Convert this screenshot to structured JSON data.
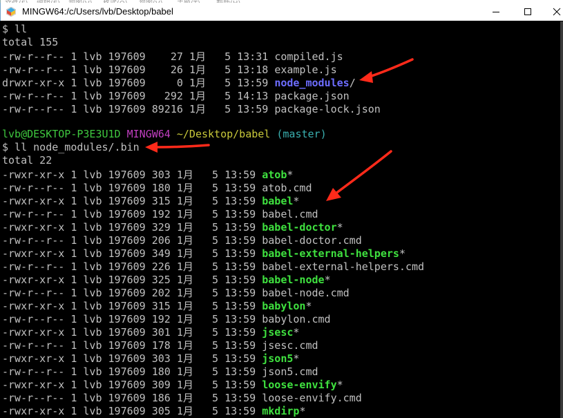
{
  "menu": [
    "文件(F)",
    "编辑(E)",
    "视图(V)",
    "格式(O)",
    "视图(V)",
    "主题(T)",
    "帮助(H)"
  ],
  "window": {
    "title": "MINGW64:/c/Users/lvb/Desktop/babel",
    "minimize_glyph": "—",
    "maximize_glyph": "☐",
    "close_glyph": "✕",
    "icon": "mingw-app-icon"
  },
  "terminal": {
    "command1": "$ ll",
    "total1": "total 155",
    "files1": [
      {
        "perms": "-rw-r--r--",
        "links": "1",
        "owner": "lvb",
        "group": "197609",
        "size": "   27",
        "month": "1月",
        "day": "5",
        "time": "13:31",
        "name": "compiled.js",
        "type": "file"
      },
      {
        "perms": "-rw-r--r--",
        "links": "1",
        "owner": "lvb",
        "group": "197609",
        "size": "   26",
        "month": "1月",
        "day": "5",
        "time": "13:18",
        "name": "example.js",
        "type": "file"
      },
      {
        "perms": "drwxr-xr-x",
        "links": "1",
        "owner": "lvb",
        "group": "197609",
        "size": "    0",
        "month": "1月",
        "day": "5",
        "time": "13:59",
        "name": "node_modules",
        "suffix": "/",
        "type": "dir"
      },
      {
        "perms": "-rw-r--r--",
        "links": "1",
        "owner": "lvb",
        "group": "197609",
        "size": "  292",
        "month": "1月",
        "day": "5",
        "time": "14:13",
        "name": "package.json",
        "type": "file"
      },
      {
        "perms": "-rw-r--r--",
        "links": "1",
        "owner": "lvb",
        "group": "197609",
        "size": "89216",
        "month": "1月",
        "day": "5",
        "time": "13:59",
        "name": "package-lock.json",
        "type": "file"
      }
    ],
    "prompt": {
      "user_host": "lvb@DESKTOP-P3E3U1D",
      "shell": "MINGW64",
      "path": "~/Desktop/babel",
      "branch": "(master)"
    },
    "command2": "$ ll node_modules/.bin",
    "total2": "total 22",
    "files2": [
      {
        "perms": "-rwxr-xr-x",
        "size": "303",
        "time": "13:59",
        "name": "atob",
        "suffix": "*",
        "type": "exe"
      },
      {
        "perms": "-rw-r--r--",
        "size": "180",
        "time": "13:59",
        "name": "atob.cmd",
        "type": "file"
      },
      {
        "perms": "-rwxr-xr-x",
        "size": "315",
        "time": "13:59",
        "name": "babel",
        "suffix": "*",
        "type": "exe"
      },
      {
        "perms": "-rw-r--r--",
        "size": "192",
        "time": "13:59",
        "name": "babel.cmd",
        "type": "file"
      },
      {
        "perms": "-rwxr-xr-x",
        "size": "329",
        "time": "13:59",
        "name": "babel-doctor",
        "suffix": "*",
        "type": "exe"
      },
      {
        "perms": "-rw-r--r--",
        "size": "206",
        "time": "13:59",
        "name": "babel-doctor.cmd",
        "type": "file"
      },
      {
        "perms": "-rwxr-xr-x",
        "size": "349",
        "time": "13:59",
        "name": "babel-external-helpers",
        "suffix": "*",
        "type": "exe"
      },
      {
        "perms": "-rw-r--r--",
        "size": "226",
        "time": "13:59",
        "name": "babel-external-helpers.cmd",
        "type": "file"
      },
      {
        "perms": "-rwxr-xr-x",
        "size": "325",
        "time": "13:59",
        "name": "babel-node",
        "suffix": "*",
        "type": "exe"
      },
      {
        "perms": "-rw-r--r--",
        "size": "202",
        "time": "13:59",
        "name": "babel-node.cmd",
        "type": "file"
      },
      {
        "perms": "-rwxr-xr-x",
        "size": "315",
        "time": "13:59",
        "name": "babylon",
        "suffix": "*",
        "type": "exe"
      },
      {
        "perms": "-rw-r--r--",
        "size": "192",
        "time": "13:59",
        "name": "babylon.cmd",
        "type": "file"
      },
      {
        "perms": "-rwxr-xr-x",
        "size": "301",
        "time": "13:59",
        "name": "jsesc",
        "suffix": "*",
        "type": "exe"
      },
      {
        "perms": "-rw-r--r--",
        "size": "178",
        "time": "13:59",
        "name": "jsesc.cmd",
        "type": "file"
      },
      {
        "perms": "-rwxr-xr-x",
        "size": "303",
        "time": "13:59",
        "name": "json5",
        "suffix": "*",
        "type": "exe"
      },
      {
        "perms": "-rw-r--r--",
        "size": "180",
        "time": "13:59",
        "name": "json5.cmd",
        "type": "file"
      },
      {
        "perms": "-rwxr-xr-x",
        "size": "309",
        "time": "13:59",
        "name": "loose-envify",
        "suffix": "*",
        "type": "exe"
      },
      {
        "perms": "-rw-r--r--",
        "size": "186",
        "time": "13:59",
        "name": "loose-envify.cmd",
        "type": "file"
      },
      {
        "perms": "-rwxr-xr-x",
        "size": "305",
        "time": "13:59",
        "name": "mkdirp",
        "suffix": "*",
        "type": "exe"
      }
    ],
    "files2_links": "1",
    "files2_owner": "lvb",
    "files2_group": "197609",
    "files2_month": "1月",
    "files2_day": "5"
  },
  "colors": {
    "background": "#000000",
    "text": "#c0c0c0",
    "directory": "#6d6dff",
    "executable": "#3fe13f",
    "prompt_user": "#3fc93f",
    "prompt_shell": "#c13fc1",
    "prompt_path": "#c9c93a",
    "prompt_branch": "#3ab0b0",
    "annotation_arrow": "#ff2a1a"
  },
  "annotations": [
    "red-arrow",
    "red-arrow",
    "red-arrow"
  ]
}
